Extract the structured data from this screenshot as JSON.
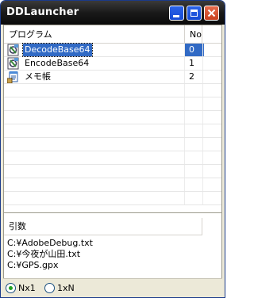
{
  "window": {
    "title": "DDLauncher"
  },
  "list": {
    "columns": [
      "プログラム",
      "No"
    ],
    "rows": [
      {
        "name": "DecodeBase64",
        "no": "0",
        "selected": true,
        "icon": "app-icon"
      },
      {
        "name": "EncodeBase64",
        "no": "1",
        "selected": false,
        "icon": "app-icon"
      },
      {
        "name": "メモ帳",
        "no": "2",
        "selected": false,
        "icon": "notepad-icon"
      }
    ]
  },
  "args": {
    "header": "引数",
    "items": [
      "C:¥AdobeDebug.txt",
      "C:¥今夜が山田.txt",
      "C:¥GPS.gpx"
    ]
  },
  "radios": [
    {
      "label": "Nx1",
      "checked": true
    },
    {
      "label": "1xN",
      "checked": false
    }
  ],
  "colors": {
    "selection": "#316ac5",
    "title_bg": "#1a1a1a",
    "close": "#c8401e"
  }
}
